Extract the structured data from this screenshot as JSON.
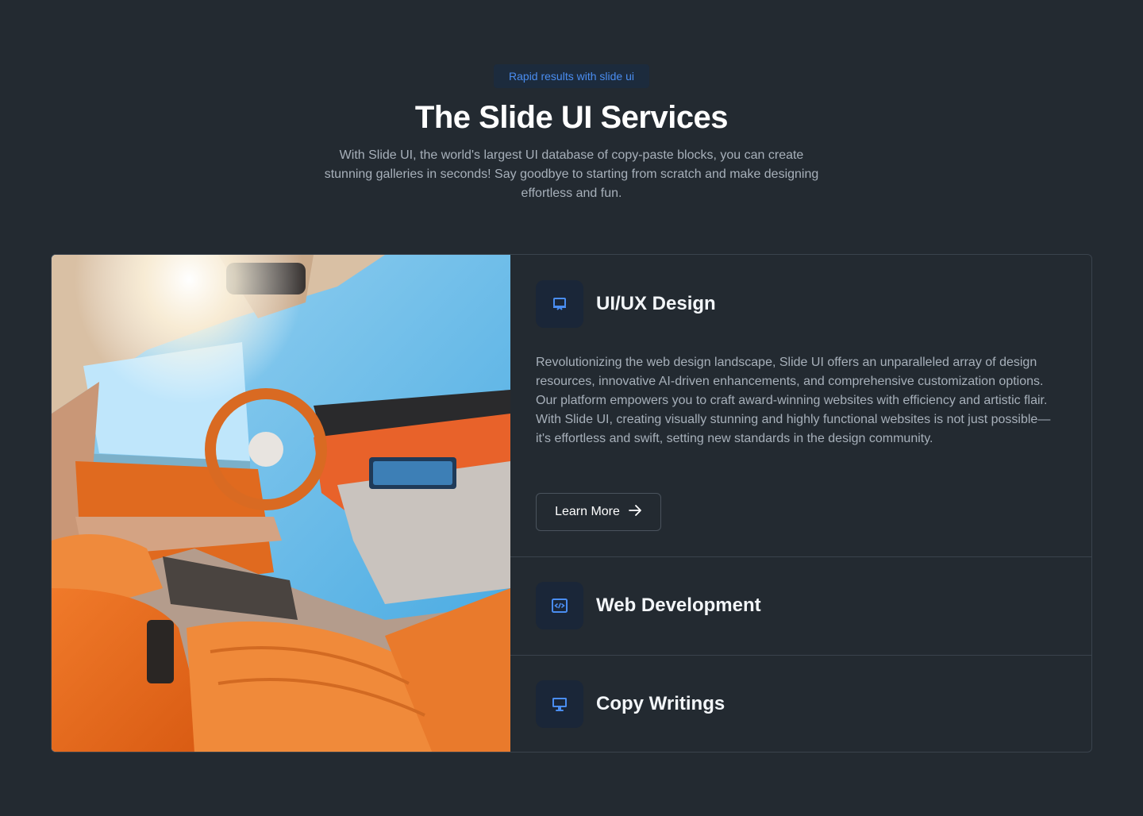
{
  "header": {
    "badge": "Rapid results with slide ui",
    "title": "The Slide UI Services",
    "subtitle": "With Slide UI, the world's largest UI database of copy-paste blocks, you can create stunning galleries in seconds! Say goodbye to starting from scratch and make designing effortless and fun."
  },
  "colors": {
    "background": "#232a31",
    "accent": "#4a8df0",
    "icon_bg": "#1a2638"
  },
  "image": {
    "subject": "car-interior-photo"
  },
  "services": [
    {
      "title": "UI/UX Design",
      "icon": "presentation-icon",
      "expanded": true,
      "description": "Revolutionizing the web design landscape, Slide UI offers an unparalleled array of design resources, innovative AI-driven enhancements, and comprehensive customization options. Our platform empowers you to craft award-winning websites with efficiency and artistic flair. With Slide UI, creating visually stunning and highly functional websites is not just possible—it's effortless and swift, setting new standards in the design community.",
      "button_label": "Learn More",
      "button_icon": "arrow-right-icon"
    },
    {
      "title": "Web Development",
      "icon": "code-window-icon",
      "expanded": false
    },
    {
      "title": "Copy Writings",
      "icon": "monitor-icon",
      "expanded": false
    }
  ]
}
